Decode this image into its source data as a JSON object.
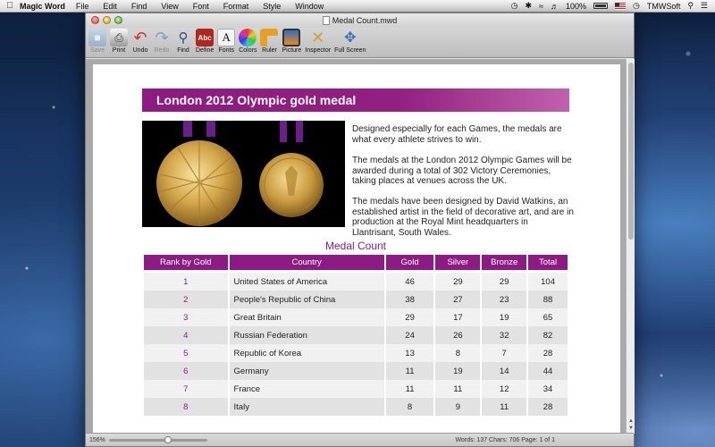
{
  "menubar": {
    "app_name": "Magic Word",
    "items": [
      "File",
      "Edit",
      "Find",
      "View",
      "Font",
      "Format",
      "Style",
      "Window"
    ],
    "battery": "100%",
    "user": "TMWSoft"
  },
  "window": {
    "title": "Medal Count.mwd"
  },
  "toolbar": {
    "items": [
      {
        "label": "Save",
        "icon": "save-icon",
        "enabled": false
      },
      {
        "label": "Print",
        "icon": "print-icon",
        "enabled": true
      },
      {
        "label": "Undo",
        "icon": "undo-icon",
        "enabled": true
      },
      {
        "label": "Redo",
        "icon": "redo-icon",
        "enabled": false
      },
      {
        "label": "Find",
        "icon": "find-icon",
        "enabled": true
      },
      {
        "label": "Define",
        "icon": "define-icon",
        "enabled": true
      },
      {
        "label": "Fonts",
        "icon": "fonts-icon",
        "enabled": true
      },
      {
        "label": "Colors",
        "icon": "colors-icon",
        "enabled": true
      },
      {
        "label": "Ruler",
        "icon": "ruler-icon",
        "enabled": true
      },
      {
        "label": "Picture",
        "icon": "picture-icon",
        "enabled": true
      },
      {
        "label": "Inspector",
        "icon": "inspector-icon",
        "enabled": true
      },
      {
        "label": "Full Screen",
        "icon": "fullscreen-icon",
        "enabled": true
      }
    ]
  },
  "document": {
    "heading": "London 2012 Olympic gold medal",
    "paragraphs": [
      "Designed especially for each Games, the medals are what every athlete strives to win.",
      "The medals at the London 2012 Olympic Games will be awarded during a total of 302 Victory Ceremonies, taking places at venues across the UK.",
      "The medals have been designed by David Watkins, an established artist in the field of decorative art, and are in production at the Royal Mint headquarters in Llantrisant, South Wales."
    ],
    "table_title": "Medal Count",
    "table": {
      "headers": [
        "Rank by Gold",
        "Country",
        "Gold",
        "Silver",
        "Bronze",
        "Total"
      ],
      "rows": [
        [
          "1",
          "United States of America",
          "46",
          "29",
          "29",
          "104"
        ],
        [
          "2",
          "People's Republic of China",
          "38",
          "27",
          "23",
          "88"
        ],
        [
          "3",
          "Great Britain",
          "29",
          "17",
          "19",
          "65"
        ],
        [
          "4",
          "Russian Federation",
          "24",
          "26",
          "32",
          "82"
        ],
        [
          "5",
          "Republic of Korea",
          "13",
          "8",
          "7",
          "28"
        ],
        [
          "6",
          "Germany",
          "11",
          "19",
          "14",
          "44"
        ],
        [
          "7",
          "France",
          "11",
          "11",
          "12",
          "34"
        ],
        [
          "8",
          "Italy",
          "8",
          "9",
          "11",
          "28"
        ]
      ]
    }
  },
  "statusbar": {
    "zoom": "156%",
    "stats": "Words: 137  Chars: 706  Page: 1 of 1"
  },
  "colors": {
    "accent": "#8e1a83"
  }
}
